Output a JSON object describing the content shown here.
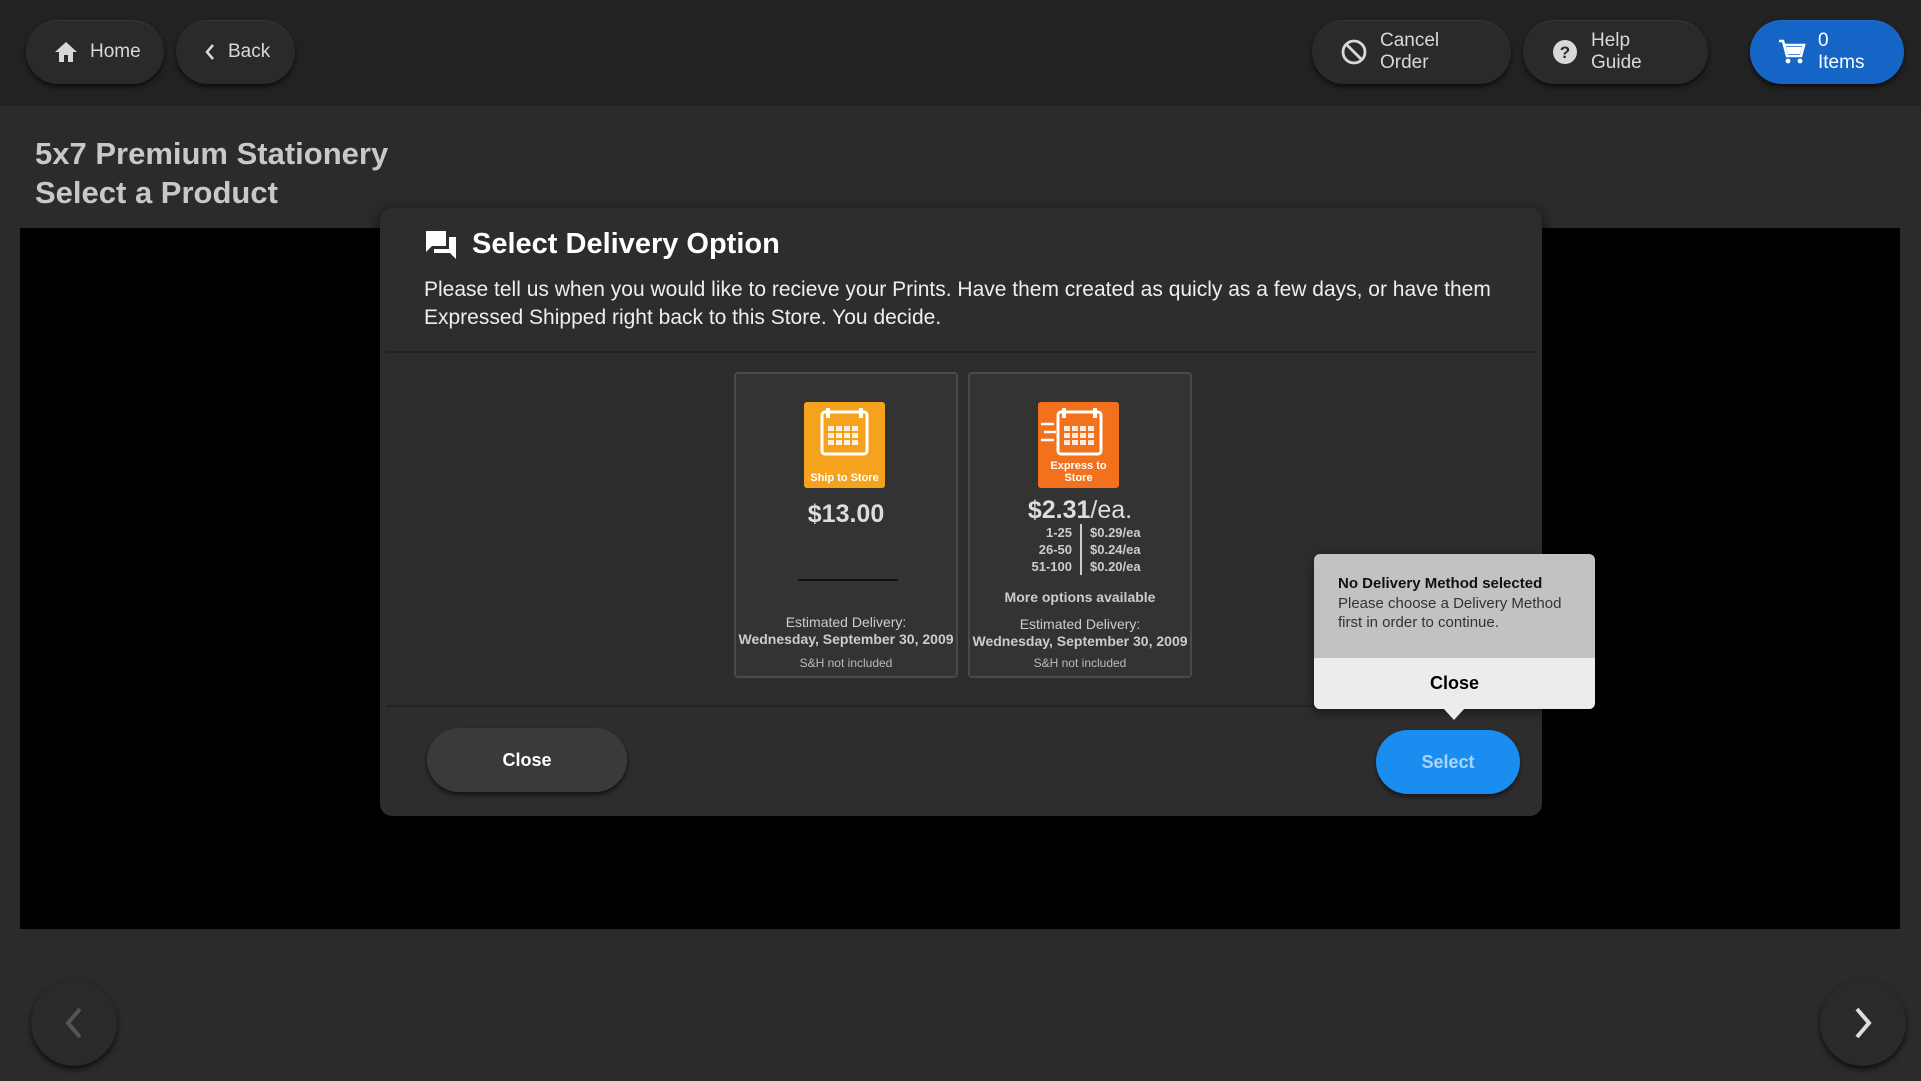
{
  "header": {
    "home_label": "Home",
    "back_label": "Back",
    "cancel_label": "Cancel Order",
    "help_label": "Help Guide",
    "cart_label": "0 Items"
  },
  "page": {
    "title_line1": "5x7 Premium Stationery",
    "title_line2": "Select a Product"
  },
  "modal": {
    "title": "Select Delivery Option",
    "description": "Please tell us when you would like to recieve your Prints. Have them created as quicly as a few days, or have them Expressed Shipped right back to this Store. You decide.",
    "options": [
      {
        "icon_label": "Ship to Store",
        "price": "$13.00",
        "est_label": "Estimated Delivery:",
        "est_date": "Wednesday, September 30, 2009",
        "sh_note": "S&H not included",
        "icon_color": "#f5a31c"
      },
      {
        "icon_label": "Express to Store",
        "price_main": "$2.31",
        "price_unit": "/ea.",
        "tiers": [
          {
            "qty": "1-25",
            "price": "$0.29/ea"
          },
          {
            "qty": "26-50",
            "price": "$0.24/ea"
          },
          {
            "qty": "51-100",
            "price": "$0.20/ea"
          }
        ],
        "more": "More options available",
        "est_label": "Estimated Delivery:",
        "est_date": "Wednesday, September 30, 2009",
        "sh_note": "S&H not included",
        "icon_color": "#f2711c"
      }
    ],
    "close_label": "Close",
    "select_label": "Select"
  },
  "tooltip": {
    "title": "No Delivery Method selected",
    "message": "Please choose a Delivery Method first in order to continue.",
    "close_label": "Close"
  },
  "colors": {
    "accent": "#1565c7",
    "select": "#1a8ef0"
  }
}
